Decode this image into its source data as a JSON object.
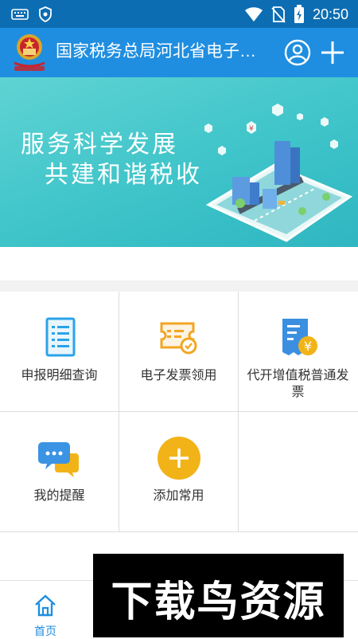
{
  "status_bar": {
    "time": "20:50"
  },
  "app_bar": {
    "title": "国家税务总局河北省电子税…"
  },
  "banner": {
    "line1": "服务科学发展",
    "line2": "共建和谐税收"
  },
  "services": [
    {
      "label": "申报明细查询",
      "icon": "document-list-icon"
    },
    {
      "label": "电子发票领用",
      "icon": "invoice-ticket-icon"
    },
    {
      "label": "代开增值税普通发票",
      "icon": "yuan-receipt-icon"
    },
    {
      "label": "我的提醒",
      "icon": "chat-bubble-icon"
    },
    {
      "label": "添加常用",
      "icon": "plus-circle-icon"
    }
  ],
  "bottom_nav": {
    "home_label": "首页"
  },
  "watermark": {
    "text": "下载鸟资源"
  },
  "colors": {
    "status_bar": "#0d6db3",
    "app_bar": "#1f8ee0",
    "banner": "#3ec4c9",
    "accent_yellow": "#f2b318",
    "icon_blue": "#2aa3e8"
  }
}
